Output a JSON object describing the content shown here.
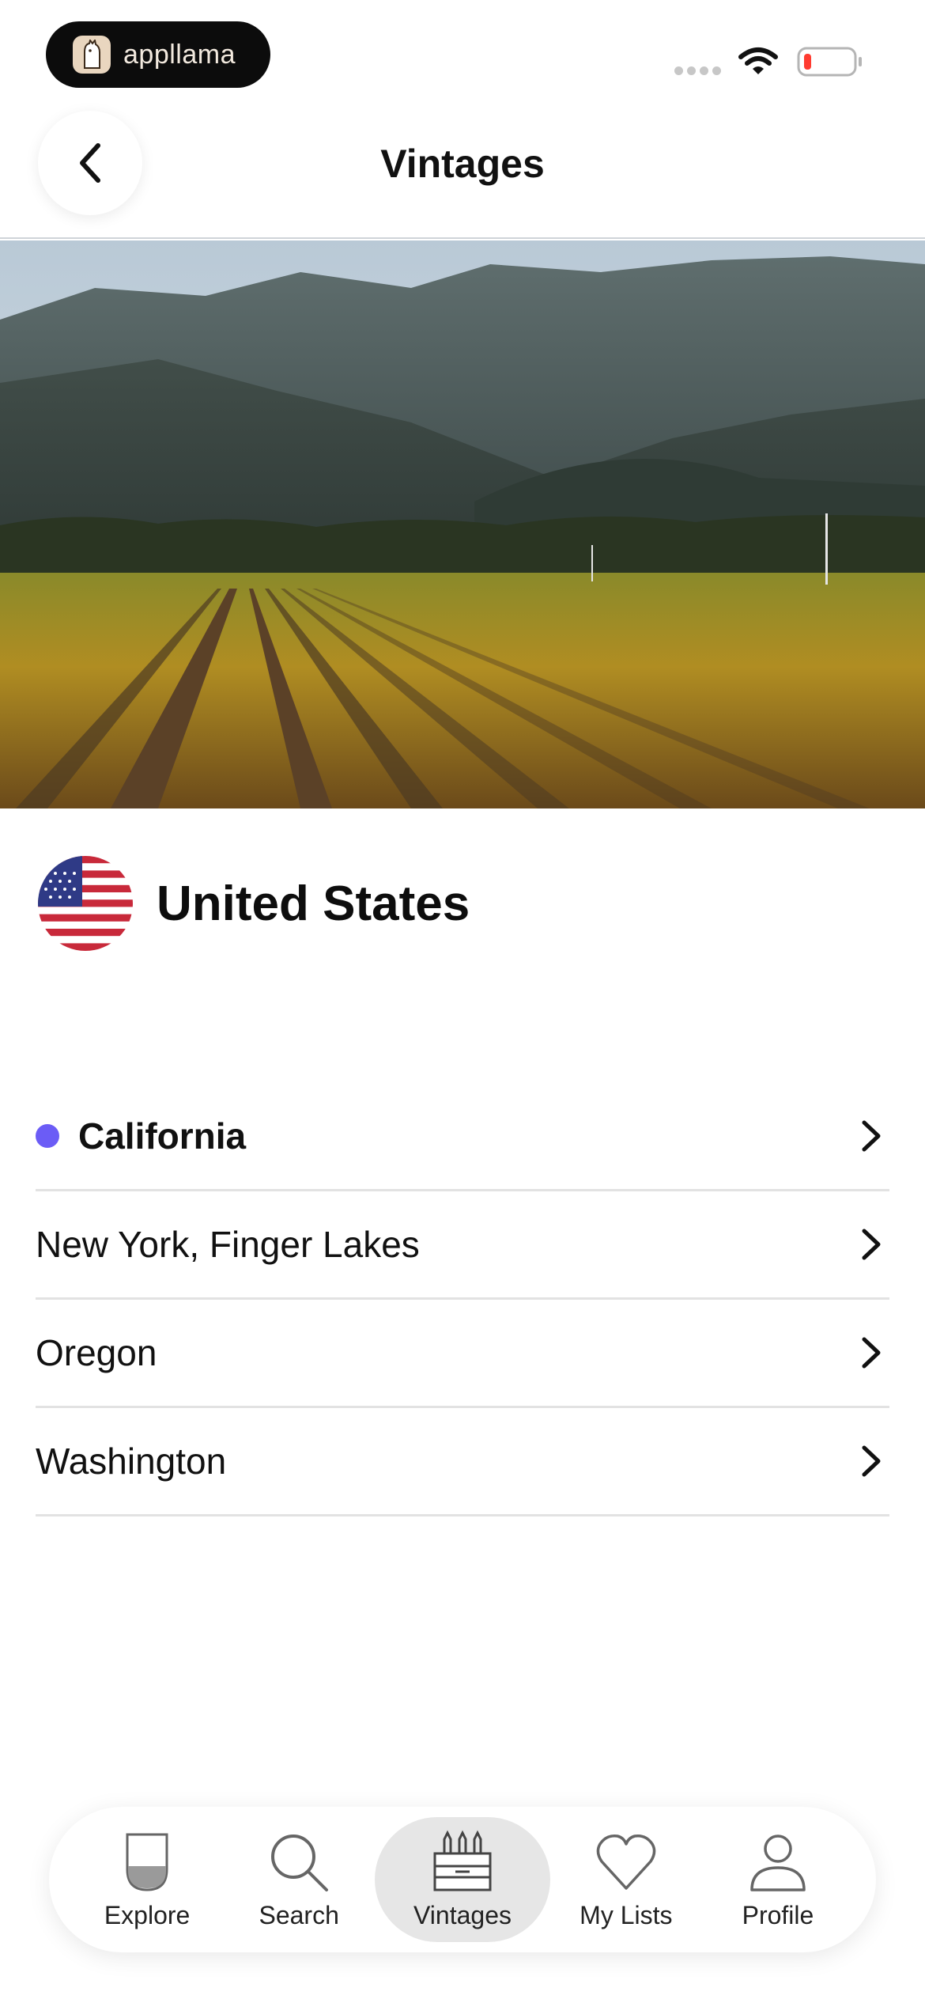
{
  "status_bar": {
    "carrier_name": "appllama"
  },
  "header": {
    "title": "Vintages",
    "back_icon": "chevron-left-icon"
  },
  "country": {
    "name": "United States",
    "flag_icon": "us-flag-icon"
  },
  "regions": [
    {
      "label": "California",
      "active": true
    },
    {
      "label": "New York, Finger Lakes",
      "active": false
    },
    {
      "label": "Oregon",
      "active": false
    },
    {
      "label": "Washington",
      "active": false
    }
  ],
  "tab_bar": {
    "tabs": [
      {
        "label": "Explore",
        "icon": "wine-glass-icon"
      },
      {
        "label": "Search",
        "icon": "search-icon"
      },
      {
        "label": "Vintages",
        "icon": "wine-crate-icon",
        "selected": true
      },
      {
        "label": "My Lists",
        "icon": "heart-icon"
      },
      {
        "label": "Profile",
        "icon": "person-icon"
      }
    ]
  },
  "colors": {
    "accent": "#6b5cf6",
    "divider": "#e2e2e2",
    "selected_tab": "#e6e6e6"
  }
}
